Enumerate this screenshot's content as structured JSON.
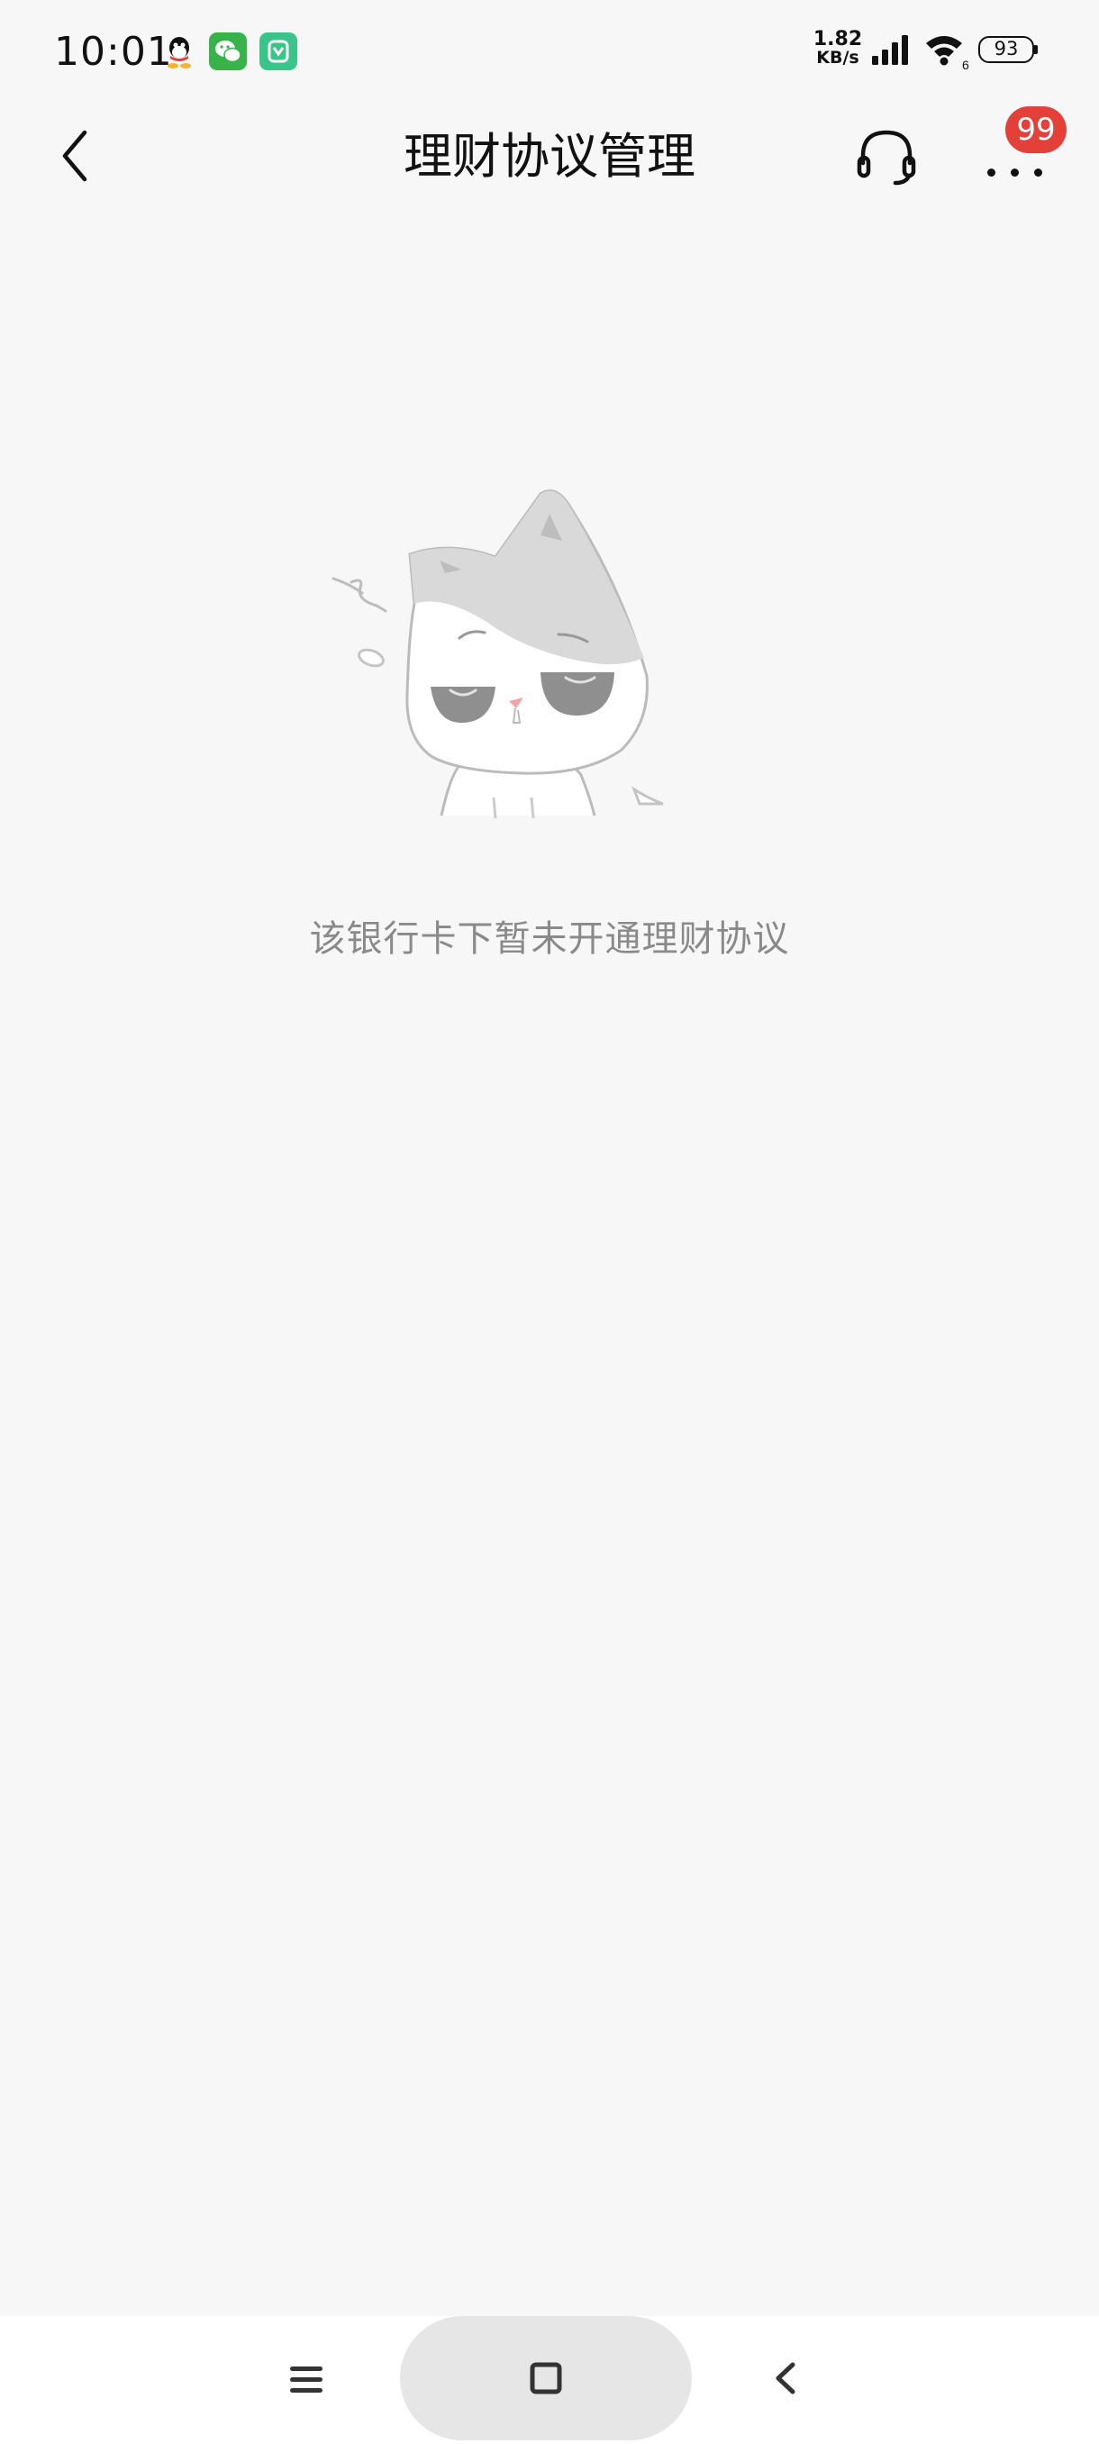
{
  "status_bar": {
    "time": "10:01",
    "net_speed_value": "1.82",
    "net_speed_unit": "KB/s",
    "wifi_label": "6",
    "battery": "93"
  },
  "nav": {
    "title": "理财协议管理",
    "badge_count": "99"
  },
  "empty_state": {
    "message": "该银行卡下暂未开通理财协议"
  },
  "colors": {
    "background": "#f7f7f7",
    "badge": "#e3403a",
    "message_text": "#8a8a8a"
  }
}
